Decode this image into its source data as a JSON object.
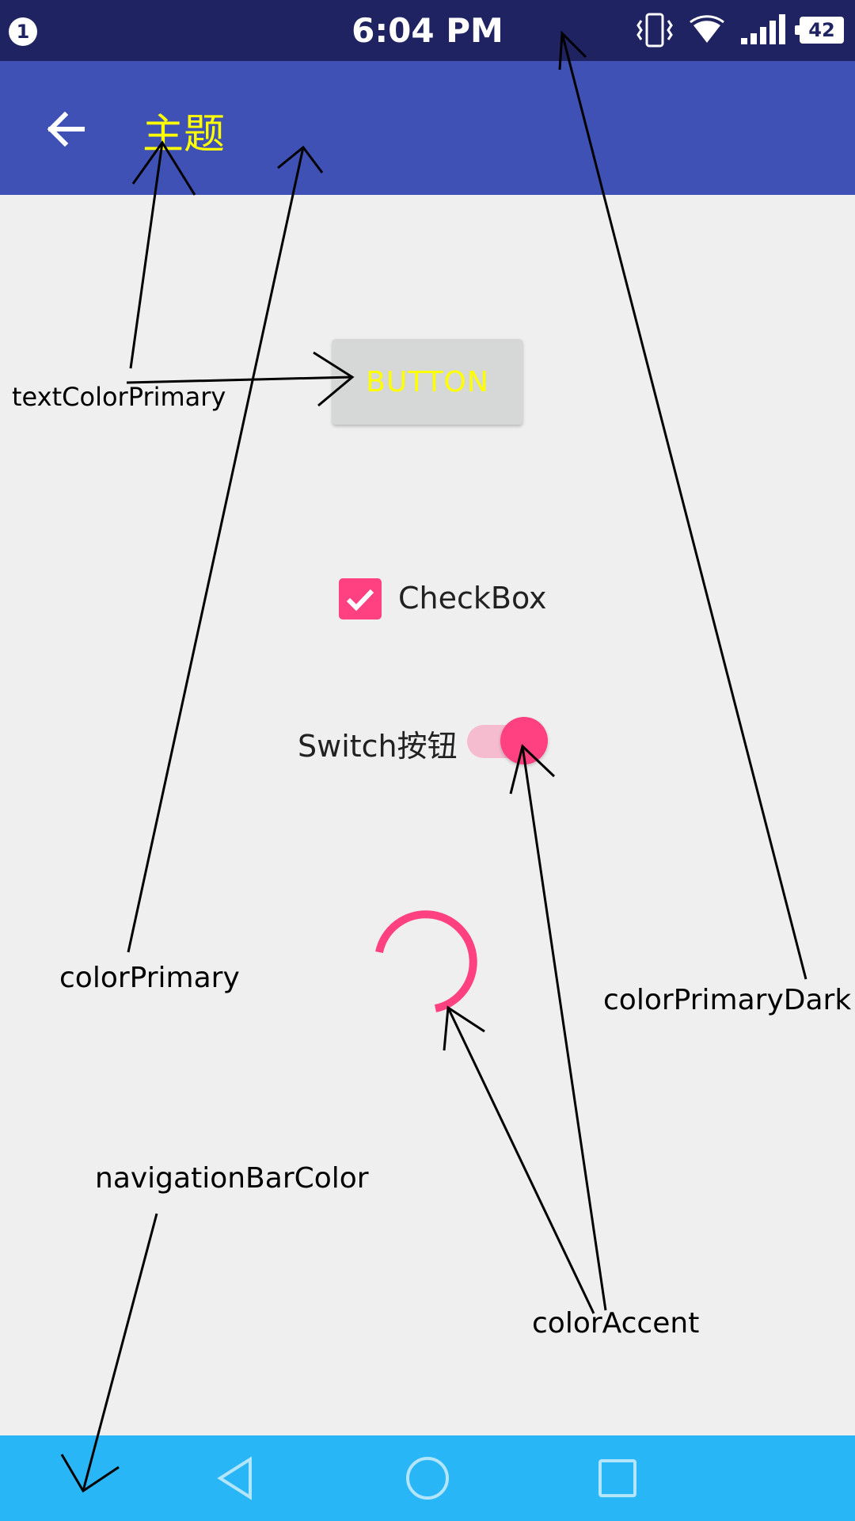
{
  "status_bar": {
    "notification_count": "1",
    "time": "6:04 PM",
    "icons": [
      "vibrate-icon",
      "wifi-icon",
      "signal-icon",
      "battery-icon"
    ],
    "battery_level": "42",
    "color": "#1f2361"
  },
  "app_bar": {
    "back_icon": "arrow-left-icon",
    "title": "主题",
    "color": "#3f51b5",
    "title_color": "#ffff00"
  },
  "content": {
    "button_label": "BUTTON",
    "checkbox": {
      "label": "CheckBox",
      "checked": true
    },
    "switch": {
      "label": "Switch按钮",
      "on": true
    },
    "accent_color": "#ff4081"
  },
  "annotations": {
    "text_color_primary": "textColorPrimary",
    "color_primary": "colorPrimary",
    "color_primary_dark": "colorPrimaryDark",
    "navigation_bar_color": "navigationBarColor",
    "color_accent": "colorAccent"
  },
  "nav_bar": {
    "color": "#29b6f6",
    "buttons": [
      "back-triangle-icon",
      "home-circle-icon",
      "recents-square-icon"
    ]
  }
}
